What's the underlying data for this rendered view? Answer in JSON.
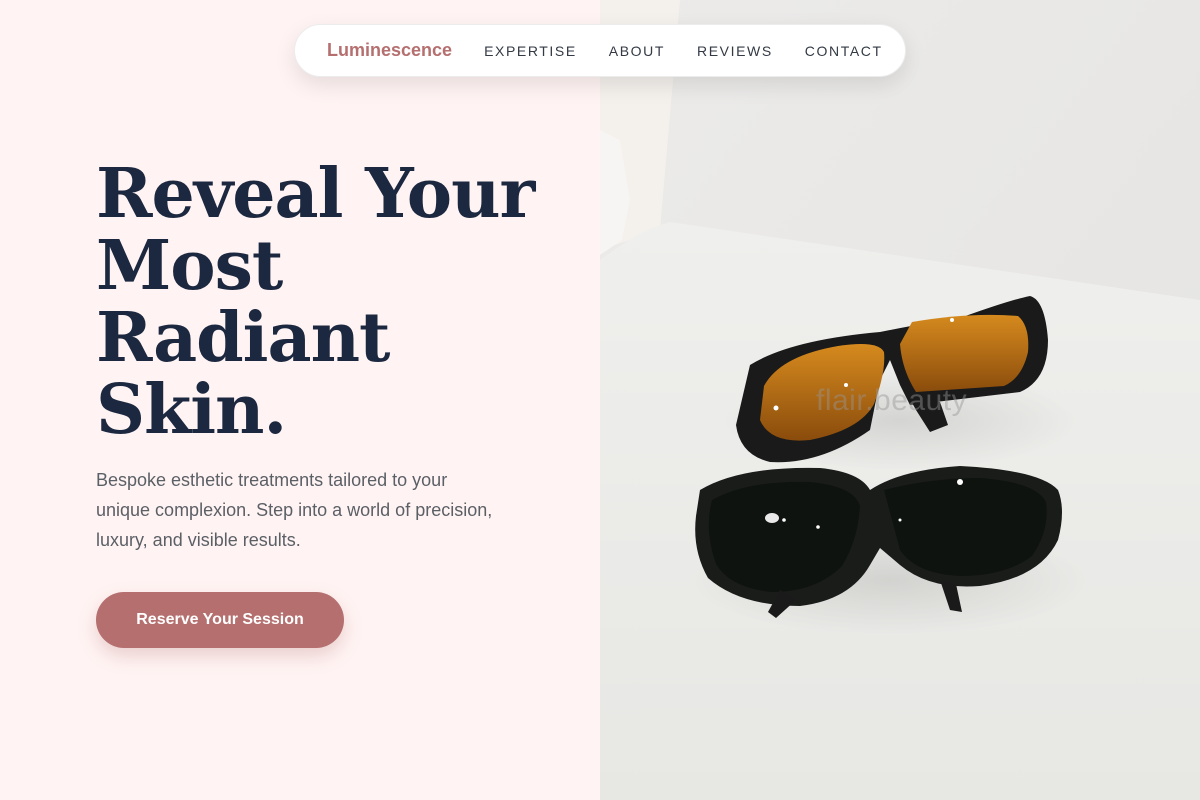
{
  "nav": {
    "brand": "Luminescence",
    "links": [
      "EXPERTISE",
      "ABOUT",
      "REVIEWS",
      "CONTACT"
    ]
  },
  "hero": {
    "title_lines": [
      "Reveal Your",
      "Most",
      "Radiant",
      "Skin."
    ],
    "subtitle": "Bespoke esthetic treatments tailored to your unique complexion. Step into a world of precision, luxury, and visible results.",
    "cta_label": "Reserve Your Session"
  },
  "image": {
    "watermark": "flair.beauty",
    "subject": "sunglasses-photo"
  },
  "colors": {
    "background": "#fff4f3",
    "brand": "#b56f6f",
    "heading": "#1c2840",
    "body_text": "#5b5f66",
    "nav_text": "#333a44"
  }
}
